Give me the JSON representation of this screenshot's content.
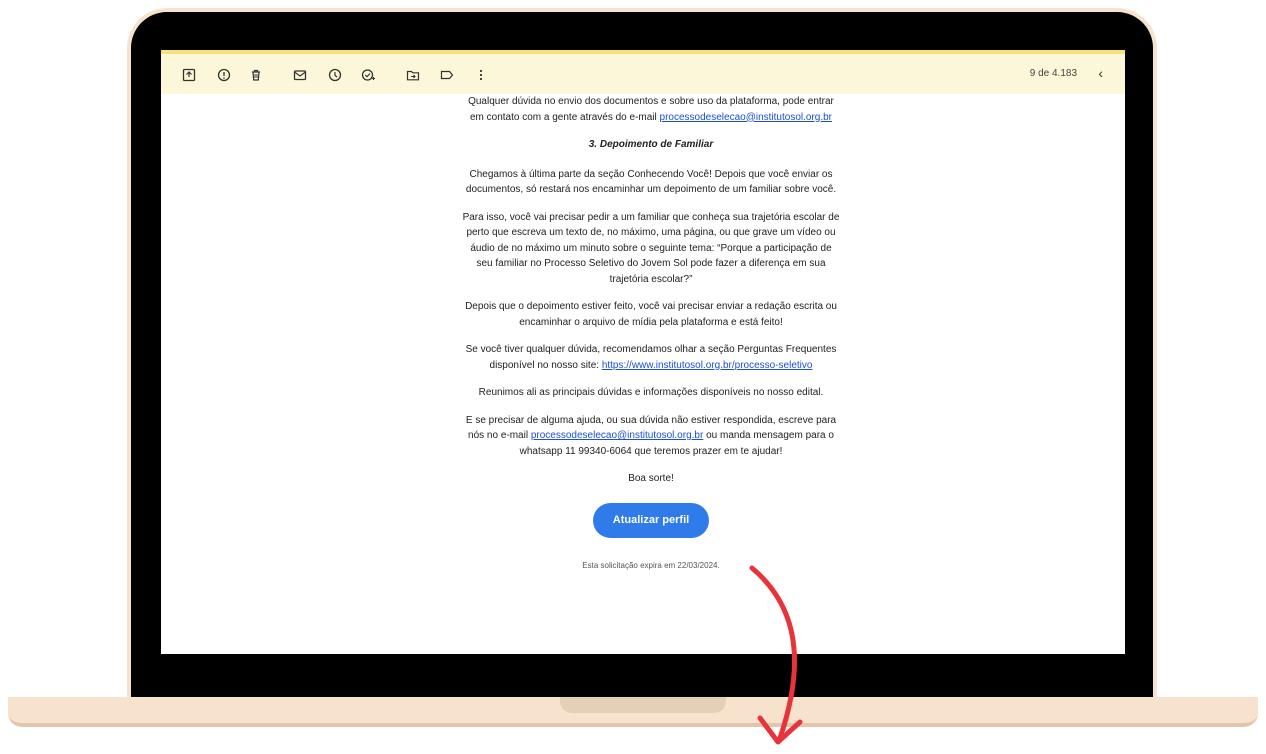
{
  "toolbar": {
    "icons": [
      "archive-icon",
      "report-spam-icon",
      "delete-icon",
      "mark-unread-icon",
      "snooze-icon",
      "add-task-icon",
      "move-to-icon",
      "label-icon",
      "more-options-icon"
    ],
    "pager_text": "9 de 4.183",
    "back_glyph": "‹"
  },
  "email": {
    "intro": {
      "text": "Qualquer dúvida no envio dos documentos e sobre uso da plataforma, pode entrar em contato com a gente através do e-mail ",
      "link": "processodeselecao@institutosol.org.br"
    },
    "section_heading": "3. Depoimento de Familiar",
    "p1": "Chegamos à última parte da seção Conhecendo Você! Depois que você enviar os documentos, só restará nos encaminhar um depoimento de um familiar sobre você.",
    "p2": "Para isso, você vai precisar pedir a um familiar que conheça sua trajetória escolar de perto que escreva um texto de, no máximo, uma página, ou que grave um vídeo ou áudio de no máximo um minuto sobre o seguinte tema: “Porque a participação de seu familiar no Processo Seletivo do Jovem Sol pode fazer a diferença em sua trajetória escolar?”",
    "p3": "Depois que o depoimento estiver feito, você vai precisar enviar a redação escrita ou encaminhar o arquivo de mídia pela plataforma e está feito!",
    "p4": {
      "text": "Se você tiver qualquer dúvida, recomendamos olhar a seção Perguntas Frequentes disponível no nosso site: ",
      "link": "https://www.institutosol.org.br/processo-seletivo"
    },
    "p5": "Reunimos ali as principais dúvidas e informações disponíveis no nosso edital.",
    "p6": {
      "before": "E se precisar de alguma ajuda, ou sua dúvida não estiver respondida, escreve para nós no e-mail ",
      "link": "processodeselecao@institutosol.org.br",
      "after": " ou manda mensagem para o whatsapp 11 99340-6064 que teremos prazer em te ajudar!"
    },
    "signoff": "Boa sorte!",
    "cta_label": "Atualizar perfil",
    "expiry": "Esta solicitação expira em 22/03/2024."
  },
  "colors": {
    "accent_button": "#2f7bea",
    "toolbar_bg": "#fbf7d8",
    "arrow": "#e8333a",
    "laptop_shell": "#f7e2cd"
  }
}
